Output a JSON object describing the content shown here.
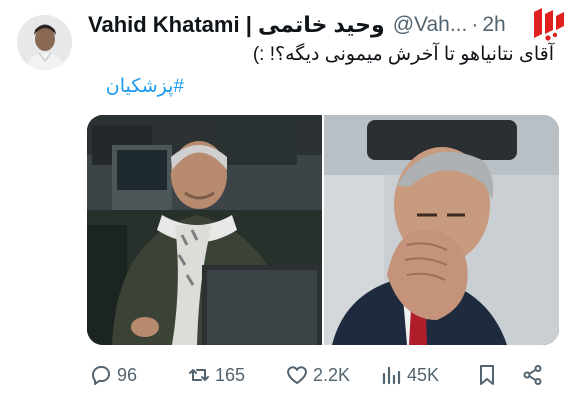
{
  "tweet": {
    "display_name": "Vahid Khatami | وحید خاتمی",
    "handle": "@Vah...",
    "separator": "·",
    "time": "2h",
    "text": "آقای نتانیاهو تا آخرش میمونی دیگه؟! :)",
    "hashtag": "#پزشکیان"
  },
  "actions": {
    "replies": "96",
    "retweets": "165",
    "likes": "2.2K",
    "views": "45K"
  },
  "icons": {
    "reply": "reply-icon",
    "retweet": "retweet-icon",
    "like": "heart-icon",
    "views": "views-icon",
    "bookmark": "bookmark-icon",
    "share": "share-icon",
    "logo": "news-agency-logo"
  },
  "colors": {
    "text": "#0f1419",
    "secondary": "#536471",
    "link": "#1d9bf0",
    "logo_red": "#e0201f"
  }
}
